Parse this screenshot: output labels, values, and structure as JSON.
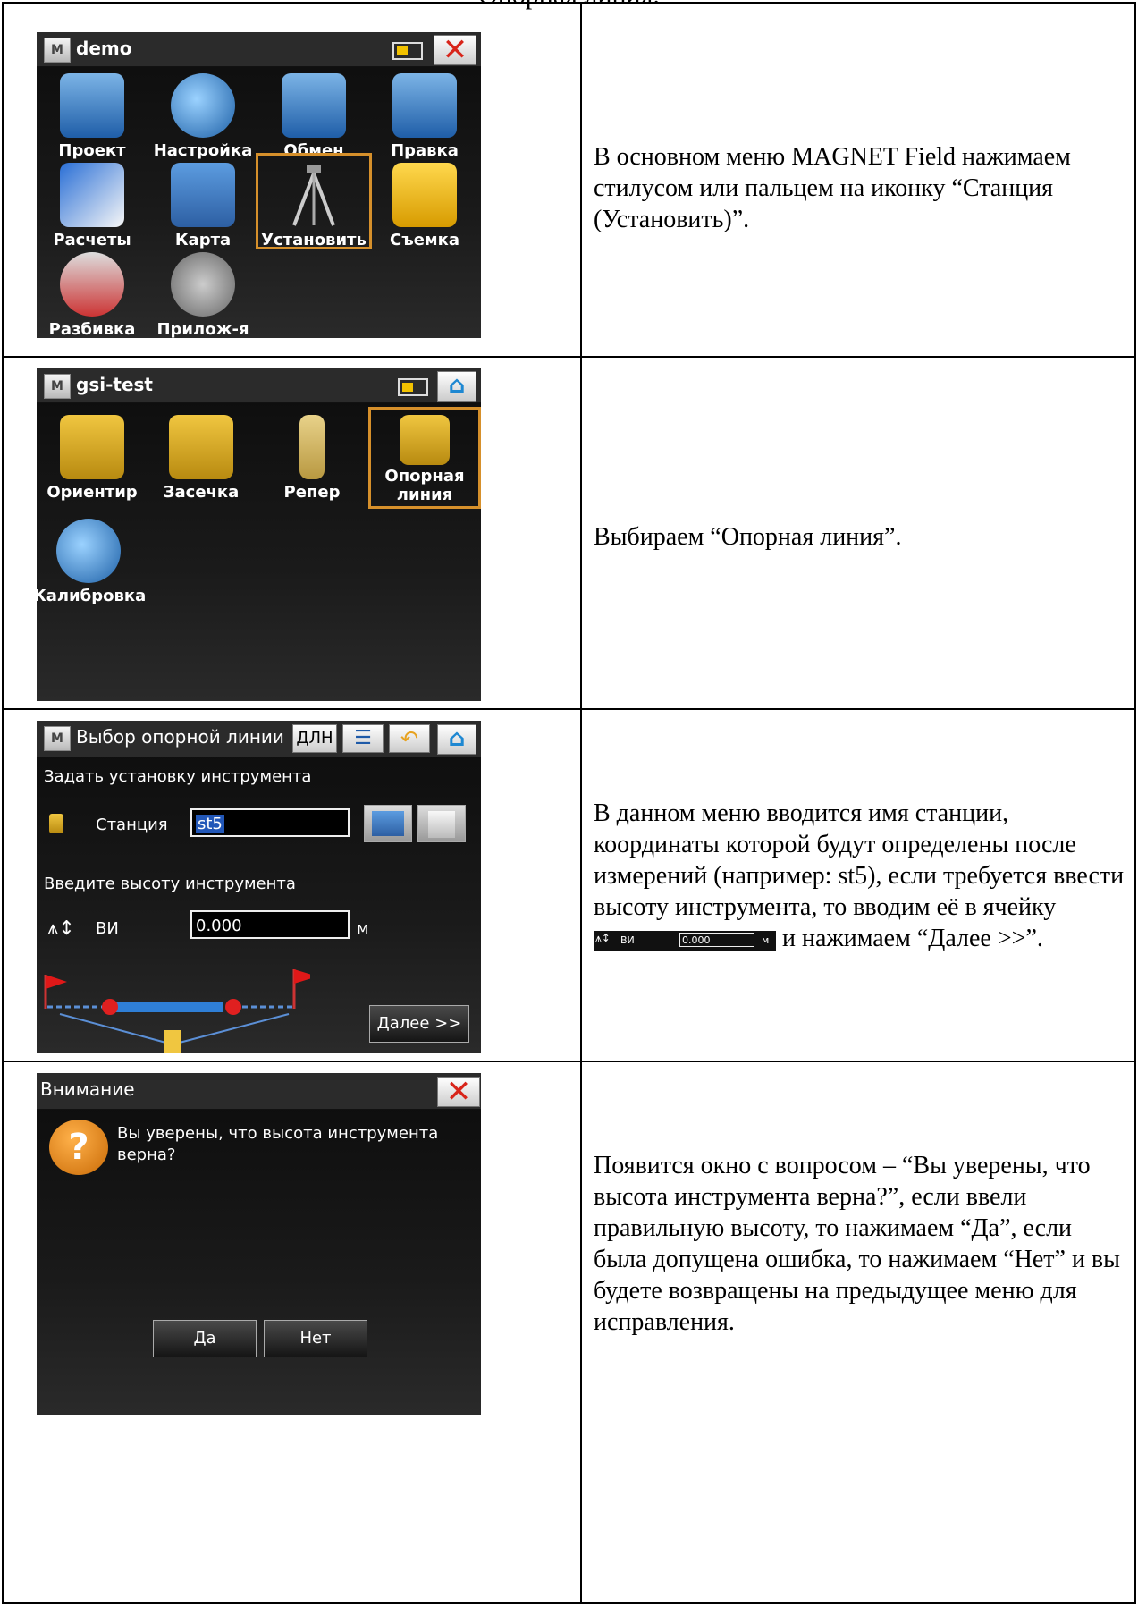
{
  "page": {
    "title": "Опорная линия."
  },
  "row1": {
    "screen_title": "demo",
    "tiles": [
      "Проект",
      "Настройка",
      "Обмен",
      "Правка",
      "Расчеты",
      "Карта",
      "Установить",
      "Съемка",
      "Разбивка",
      "Прилож-я"
    ],
    "description": "В основном меню MAGNET Field нажимаем стилусом или пальцем на иконку “Станция (Установить)”."
  },
  "row2": {
    "screen_title": "gsi-test",
    "tiles": [
      "Ориентир",
      "Засечка",
      "Репер",
      "Опорная линия",
      "Калибровка"
    ],
    "description": "Выбираем “Опорная линия”."
  },
  "row3": {
    "screen_title": "Выбор опорной линии",
    "dln_label": "ДЛН",
    "setup_label": "Задать установку инструмента",
    "station_label": "Станция",
    "station_value": "st5",
    "height_prompt": "Введите высоту инструмента",
    "hi_label": "ВИ",
    "hi_value": "0.000",
    "unit": "м",
    "next_label": "Далее >>",
    "description_a": "В данном меню вводится имя станции, координаты которой будут определены после измерений (например: st5), если требуется ввести высоту инструмента, то вводим её в ячейку",
    "description_b": "и нажимаем “Далее >>”."
  },
  "row4": {
    "screen_title": "Внимание",
    "question": "Вы уверены, что высота инструмента верна?",
    "yes_label": "Да",
    "no_label": "Нет",
    "description": "Появится окно с вопросом – “Вы уверены, что высота инструмента верна?”, если ввели правильную высоту, то нажимаем “Да”, если была допущена ошибка, то нажимаем “Нет” и вы будете возвращены на предыдущее меню для исправления."
  },
  "colors": {
    "accent": "#d6902b",
    "selection": "#2257b8",
    "close": "#d8251a",
    "home": "#1e88d2"
  }
}
